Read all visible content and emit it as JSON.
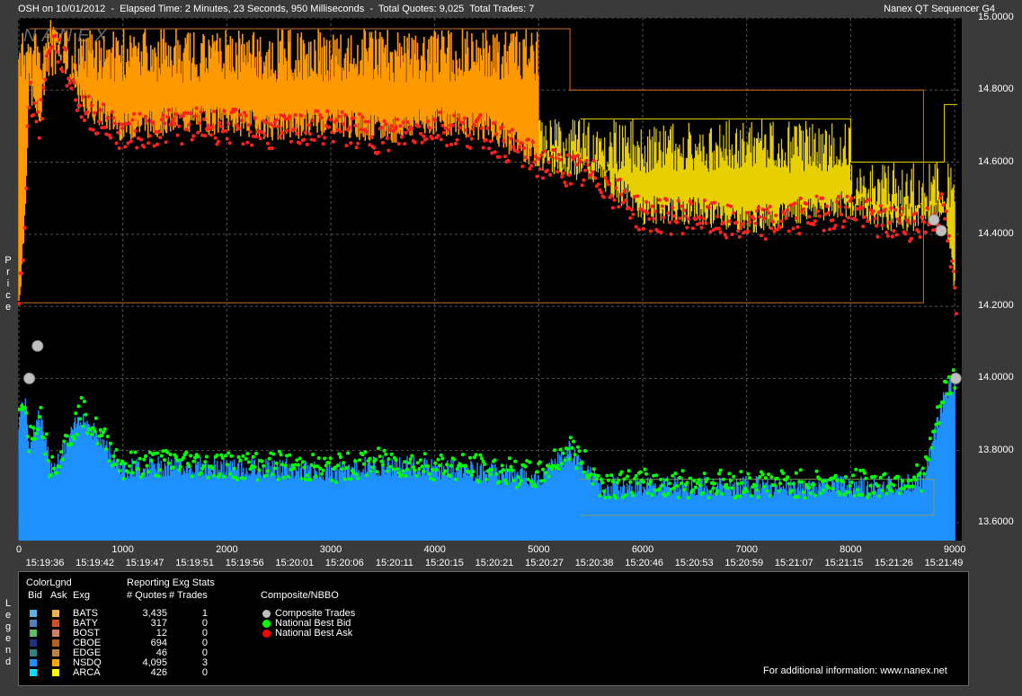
{
  "header": {
    "left": "OSH on 10/01/2012  -  Elapsed Time: 2 Minutes, 23 Seconds, 950 Milliseconds  -  Total Quotes: 9,025  Total Trades: 7",
    "right": "Nanex QT Sequencer G4"
  },
  "watermark": "NANEX",
  "y_axis_label": "Price",
  "colors": {
    "bid_nbb": "#00ff00",
    "ask_nbo": "#ff0000",
    "trade": "#c0c0c0",
    "nsdq_bid": "#1e90ff",
    "nsdq_ask": "#ffa500",
    "arca_ask": "#ffff00"
  },
  "chart_data": {
    "type": "line",
    "ylim": [
      13.55,
      15.0
    ],
    "xlim": [
      0,
      9025
    ],
    "y_ticks": [
      "15.0000",
      "14.8000",
      "14.6000",
      "14.4000",
      "14.2000",
      "14.0000",
      "13.8000",
      "13.6000"
    ],
    "x_ticks": [
      "0",
      "1000",
      "2000",
      "3000",
      "4000",
      "5000",
      "6000",
      "7000",
      "8000",
      "9000"
    ],
    "time_ticks": [
      "15:19:36",
      "15:19:42",
      "15:19:47",
      "15:19:51",
      "15:19:56",
      "15:20:01",
      "15:20:06",
      "15:20:11",
      "15:20:15",
      "15:20:21",
      "15:20:27",
      "15:20:38",
      "15:20:46",
      "15:20:53",
      "15:20:59",
      "15:21:07",
      "15:21:15",
      "15:21:26",
      "15:21:49"
    ],
    "series": [
      {
        "name": "National Best Ask",
        "x": [
          0,
          50,
          100,
          200,
          300,
          400,
          600,
          1000,
          1500,
          2000,
          2500,
          3000,
          3500,
          4000,
          4500,
          5000,
          5300,
          5600,
          6000,
          6500,
          7000,
          7500,
          8000,
          8300,
          8700,
          8900,
          9025
        ],
        "y": [
          14.2,
          14.4,
          14.8,
          14.7,
          14.95,
          14.9,
          14.75,
          14.68,
          14.7,
          14.7,
          14.68,
          14.7,
          14.67,
          14.7,
          14.68,
          14.6,
          14.58,
          14.55,
          14.45,
          14.45,
          14.42,
          14.45,
          14.47,
          14.43,
          14.43,
          14.47,
          14.17
        ]
      },
      {
        "name": "National Best Bid",
        "x": [
          0,
          50,
          100,
          200,
          300,
          400,
          600,
          1000,
          1500,
          2000,
          2500,
          3000,
          3500,
          4000,
          4500,
          5000,
          5300,
          5600,
          6000,
          6500,
          7000,
          7500,
          8000,
          8300,
          8700,
          8900,
          9025
        ],
        "y": [
          13.88,
          13.95,
          13.82,
          13.9,
          13.75,
          13.78,
          13.9,
          13.75,
          13.76,
          13.75,
          13.75,
          13.74,
          13.76,
          13.75,
          13.74,
          13.72,
          13.8,
          13.7,
          13.7,
          13.7,
          13.7,
          13.7,
          13.7,
          13.7,
          13.72,
          13.95,
          14.0
        ]
      },
      {
        "name": "Composite Trades",
        "type": "scatter",
        "x": [
          100,
          180,
          8800,
          8870,
          9010
        ],
        "y": [
          14.0,
          14.09,
          14.44,
          14.41,
          14.0
        ]
      }
    ]
  },
  "legend": {
    "title": "ColorLgnd",
    "side_label": "Legend",
    "headers": {
      "bid": "Bid",
      "ask": "Ask",
      "exg": "Exg"
    },
    "stats_title": "Reporting Exg Stats",
    "stats_headers": {
      "quotes": "# Quotes",
      "trades": "# Trades"
    },
    "exchanges": [
      {
        "name": "BATS",
        "quotes": "3,435",
        "trades": "1",
        "bid": "#60b0e0",
        "ask": "#f0b050"
      },
      {
        "name": "BATY",
        "quotes": "317",
        "trades": "0",
        "bid": "#5080c0",
        "ask": "#d05020"
      },
      {
        "name": "BOST",
        "quotes": "12",
        "trades": "0",
        "bid": "#60c060",
        "ask": "#d08060"
      },
      {
        "name": "CBOE",
        "quotes": "694",
        "trades": "0",
        "bid": "#203080",
        "ask": "#b06020"
      },
      {
        "name": "EDGE",
        "quotes": "46",
        "trades": "0",
        "bid": "#308080",
        "ask": "#c08040"
      },
      {
        "name": "NSDQ",
        "quotes": "4,095",
        "trades": "3",
        "bid": "#1e90ff",
        "ask": "#ffa500"
      },
      {
        "name": "ARCA",
        "quotes": "426",
        "trades": "0",
        "bid": "#00e0ff",
        "ask": "#ffff00"
      }
    ],
    "composite_title": "Composite/NBBO",
    "composite_items": [
      {
        "name": "Composite Trades",
        "color": "#c0c0c0"
      },
      {
        "name": "National Best Bid",
        "color": "#00ff00"
      },
      {
        "name": "National Best Ask",
        "color": "#ff0000"
      }
    ],
    "footer": "For additional information: www.nanex.net"
  }
}
